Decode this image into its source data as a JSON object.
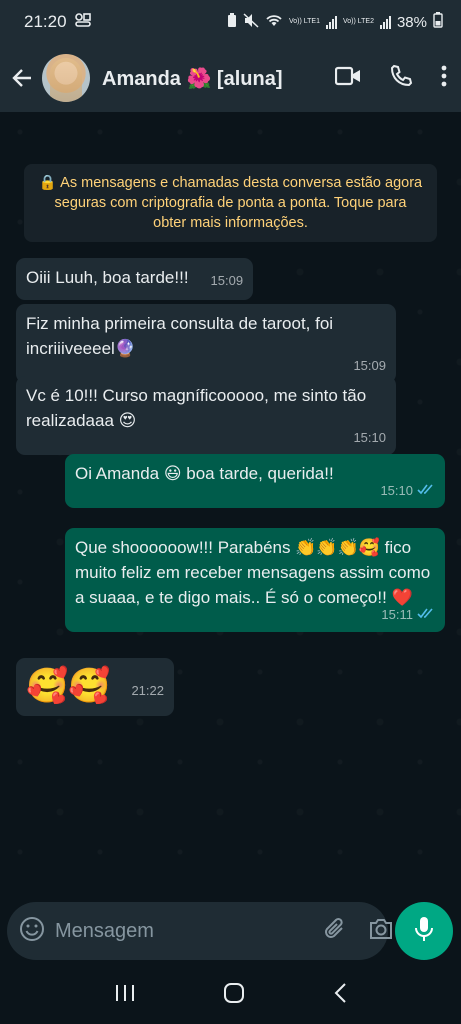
{
  "status_bar": {
    "time": "21:20",
    "sim1_label": "Vo)) LTE1",
    "sim2_label": "Vo)) LTE2",
    "battery": "38%"
  },
  "header": {
    "contact_name": "Amanda 🌺 [aluna]",
    "icons": [
      "back-arrow-icon",
      "video-call-icon",
      "phone-icon",
      "more-vert-icon"
    ]
  },
  "chat": {
    "system_notice": "🔒 As mensagens e chamadas desta conversa estão agora seguras com criptografia de ponta a ponta. Toque para obter mais informações.",
    "messages": [
      {
        "direction": "in",
        "text": "Oiii Luuh, boa tarde!!!",
        "time": "15:09"
      },
      {
        "direction": "in",
        "text": "Fiz minha primeira consulta de taroot, foi incriiiveeeel🔮",
        "time": "15:09"
      },
      {
        "direction": "in",
        "text": "Vc é 10!!! Curso magníficooooo, me sinto tão realizadaaa 😍",
        "time": "15:10"
      },
      {
        "direction": "out",
        "text": "Oi Amanda 😃 boa tarde, querida!!",
        "time": "15:10",
        "status": "read"
      },
      {
        "direction": "out",
        "text": "Que shoooooow!!! Parabéns 👏👏👏🥰 fico muito feliz em receber mensagens assim como a suaaa, e te digo mais.. É só o começo!! ❤️",
        "time": "15:11",
        "status": "read"
      },
      {
        "direction": "in",
        "text": "🥰🥰",
        "time": "21:22"
      }
    ]
  },
  "composer": {
    "placeholder": "Mensagem",
    "icons": [
      "emoji-icon",
      "attach-icon",
      "camera-icon",
      "mic-icon"
    ]
  },
  "colors": {
    "background": "#0b141a",
    "bar": "#1f2c34",
    "incoming": "#1f2c34",
    "outgoing": "#005c4b",
    "accent": "#00a884",
    "notice_text": "#ffd279",
    "read_ticks": "#53bdeb"
  }
}
